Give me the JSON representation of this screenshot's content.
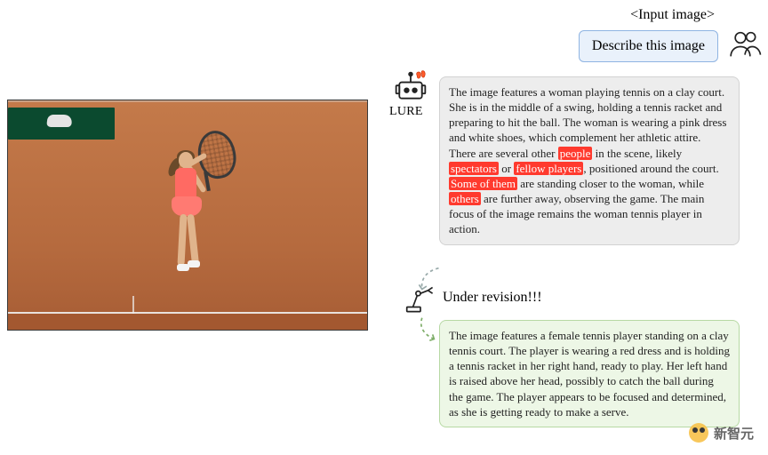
{
  "header": {
    "input_tag": "<Input image>",
    "user_prompt": "Describe this image"
  },
  "agents": {
    "lure_label": "LURE",
    "revision_label": "Under revision!!!"
  },
  "bubbles": {
    "gray": {
      "pre1": "The image features a woman playing tennis on a clay court. She is in the middle of a swing, holding a tennis racket and preparing to hit the ball. The woman is wearing a pink dress and white shoes, which complement her athletic attire. There are several other ",
      "h1": "people",
      "mid1": " in the scene, likely ",
      "h2": "spectators",
      "mid2": " or ",
      "h3": "fellow players",
      "mid3": ", positioned around the court. ",
      "h4": "Some of them",
      "mid4": " are standing closer to the woman, while ",
      "h5": "others",
      "post": " are further away, observing the game. The main focus of the image remains the woman tennis player in action."
    },
    "green": "The image features a female tennis player standing on a clay tennis court. The player is wearing a red dress and is holding a tennis racket in her right hand, ready to play. Her left hand is raised above her head, possibly to catch the ball during the game. The player appears to be focused and determined, as she is getting ready to make a serve."
  },
  "watermark": {
    "text": "新智元"
  },
  "image_alt": "Photo of a woman on a clay tennis court mid-serve, wearing a pink/red dress and white shoes, holding a tennis racket."
}
